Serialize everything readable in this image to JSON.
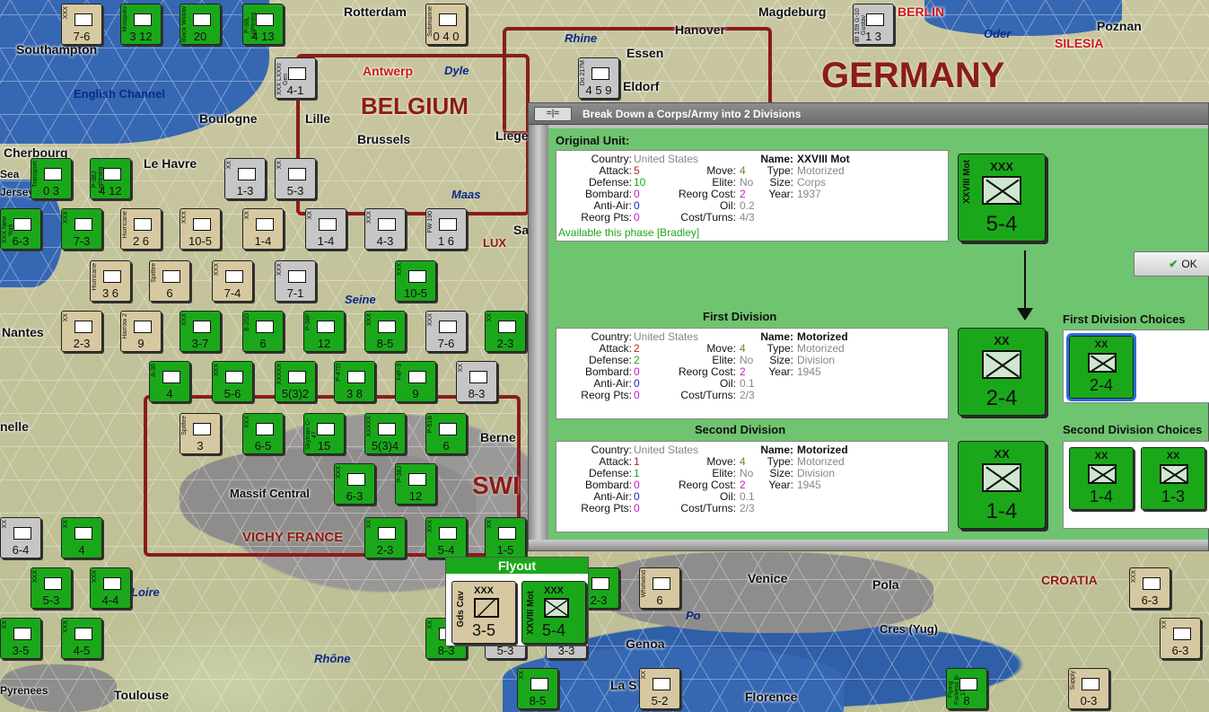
{
  "map": {
    "countries": [
      {
        "id": "germany",
        "label": "GERMANY"
      },
      {
        "id": "belgium",
        "label": "BELGIUM"
      },
      {
        "id": "vichy",
        "label": "VICHY FRANCE"
      },
      {
        "id": "croatia",
        "label": "CROATIA"
      },
      {
        "id": "lux",
        "label": "LUX"
      },
      {
        "id": "swi",
        "label": "SWI"
      }
    ],
    "places": [
      "Rotterdam",
      "Magdeburg",
      "BERLIN",
      "Poznan",
      "Hanover",
      "Essen",
      "Eldorf",
      "Southampton",
      "Boulogne",
      "Lille",
      "Brussels",
      "Liege",
      "Cherbourg",
      "Le Havre",
      "Nantes",
      "Berne",
      "Massif Central",
      "Venice",
      "Pola",
      "Cres (Yug)",
      "Genoa",
      "Toulouse",
      "Pyrenees",
      "Florence",
      "La S",
      "Antwerp",
      "SILESIA",
      "Jersey",
      "Sea",
      "nelle",
      "Sa"
    ],
    "waters": [
      "English Channel",
      "Rhine",
      "Dyle",
      "Oder",
      "Maas",
      "Seine",
      "Rhône",
      "Po",
      "Loire"
    ]
  },
  "counters": [
    {
      "id": "c1",
      "type": "XXX",
      "strength": "7-6",
      "color": "tan"
    },
    {
      "id": "c2",
      "type": "Mosquito",
      "strength": "3 12",
      "color": "g"
    },
    {
      "id": "c3",
      "type": "Black Widow",
      "strength": "20",
      "color": "g"
    },
    {
      "id": "c4",
      "type": "P-38L Lightning",
      "strength": "4 13",
      "color": "g"
    },
    {
      "id": "c5",
      "type": "Submarine",
      "strength": "0 4 0",
      "color": "tan"
    },
    {
      "id": "c6",
      "type": "Bf 109 G-10 Gustav",
      "strength": "1 3",
      "color": "gr"
    },
    {
      "id": "c7",
      "type": "XXX LXXXI Gen",
      "strength": "4-1",
      "color": "gr"
    },
    {
      "id": "c8",
      "type": "Do 217M",
      "strength": "4 5 9",
      "color": "gr"
    },
    {
      "id": "c9",
      "type": "Transport",
      "strength": "0 3",
      "color": "g"
    },
    {
      "id": "c10",
      "type": "P-38J Lightning",
      "strength": "4 12",
      "color": "g"
    },
    {
      "id": "c11",
      "type": "XX",
      "strength": "1-3",
      "color": "gr"
    },
    {
      "id": "c12",
      "type": "XX",
      "strength": "5-3",
      "color": "gr"
    },
    {
      "id": "c13",
      "type": "XXX New York",
      "strength": "6-3",
      "color": "g"
    },
    {
      "id": "c14",
      "type": "XXX",
      "strength": "7-3",
      "color": "g"
    },
    {
      "id": "c15",
      "type": "Hurricane",
      "strength": "2 6",
      "color": "tan"
    },
    {
      "id": "c16",
      "type": "XXX",
      "strength": "10-5",
      "color": "tan"
    },
    {
      "id": "c17",
      "type": "XX",
      "strength": "1-4",
      "color": "tan"
    },
    {
      "id": "c18",
      "type": "XX",
      "strength": "1-4",
      "color": "gr"
    },
    {
      "id": "c19",
      "type": "XXX",
      "strength": "4-3",
      "color": "gr"
    },
    {
      "id": "c20",
      "type": "FW 190",
      "strength": "1 6",
      "color": "gr"
    },
    {
      "id": "c21",
      "type": "XXX",
      "strength": "10-5",
      "color": "g"
    },
    {
      "id": "c22",
      "type": "Spitfire",
      "strength": "6",
      "color": "tan"
    },
    {
      "id": "c23",
      "type": "XXX",
      "strength": "7-4",
      "color": "tan"
    },
    {
      "id": "c24",
      "type": "XXX",
      "strength": "7-1",
      "color": "gr"
    },
    {
      "id": "c25",
      "type": "Hurricane",
      "strength": "3 6",
      "color": "tan"
    },
    {
      "id": "c26",
      "type": "Harrow 2",
      "strength": "9",
      "color": "tan"
    },
    {
      "id": "c27",
      "type": "XX",
      "strength": "2-3",
      "color": "tan"
    },
    {
      "id": "c28",
      "type": "XXX",
      "strength": "3-7",
      "color": "g"
    },
    {
      "id": "c29",
      "type": "B-25D",
      "strength": "6",
      "color": "g"
    },
    {
      "id": "c30",
      "type": "P-38F",
      "strength": "12",
      "color": "g"
    },
    {
      "id": "c31",
      "type": "XXX",
      "strength": "8-5",
      "color": "g"
    },
    {
      "id": "c32",
      "type": "XXX",
      "strength": "7-6",
      "color": "gr"
    },
    {
      "id": "c33",
      "type": "XX",
      "strength": "2-3",
      "color": "g"
    },
    {
      "id": "c34",
      "type": "A-36",
      "strength": "4",
      "color": "g"
    },
    {
      "id": "c35",
      "type": "XXX",
      "strength": "5-6",
      "color": "g"
    },
    {
      "id": "c36",
      "type": "XXXXX",
      "strength": "5(3)2",
      "color": "g"
    },
    {
      "id": "c37",
      "type": "P-47D",
      "strength": "3 8",
      "color": "g"
    },
    {
      "id": "c38",
      "type": "F4F-3",
      "strength": "9",
      "color": "g"
    },
    {
      "id": "c39",
      "type": "XX",
      "strength": "8-3",
      "color": "gr"
    },
    {
      "id": "c40",
      "type": "Spitfire",
      "strength": "3",
      "color": "tan"
    },
    {
      "id": "c41",
      "type": "XXX",
      "strength": "6-5",
      "color": "g"
    },
    {
      "id": "c42",
      "type": "Skytrain C-47",
      "strength": "15",
      "color": "g"
    },
    {
      "id": "c43",
      "type": "XXXXX",
      "strength": "5(3)4",
      "color": "g"
    },
    {
      "id": "c44",
      "type": "P-51B",
      "strength": "6",
      "color": "g"
    },
    {
      "id": "c45",
      "type": "XXX",
      "strength": "6-3",
      "color": "g"
    },
    {
      "id": "c46",
      "type": "P-38J",
      "strength": "12",
      "color": "g"
    },
    {
      "id": "c47",
      "type": "XX",
      "strength": "6-4",
      "color": "gr"
    },
    {
      "id": "c48",
      "type": "XX",
      "strength": "4",
      "color": "g"
    },
    {
      "id": "c49",
      "type": "XX",
      "strength": "2-3",
      "color": "g"
    },
    {
      "id": "c50",
      "type": "XXX",
      "strength": "5-4",
      "color": "g"
    },
    {
      "id": "c51",
      "type": "XX",
      "strength": "1-5",
      "color": "g"
    },
    {
      "id": "c52",
      "type": "XXX",
      "strength": "5-3",
      "color": "g"
    },
    {
      "id": "c53",
      "type": "XXX",
      "strength": "4-4",
      "color": "g"
    },
    {
      "id": "c54",
      "type": "XX",
      "strength": "3-5",
      "color": "g"
    },
    {
      "id": "c55",
      "type": "XXX",
      "strength": "4-5",
      "color": "g"
    },
    {
      "id": "c56",
      "type": "Whirlwind",
      "strength": "6",
      "color": "tan"
    },
    {
      "id": "c57",
      "type": "XXX",
      "strength": "2-3",
      "color": "g"
    },
    {
      "id": "c58",
      "type": "XXX",
      "strength": "6-3",
      "color": "tan"
    },
    {
      "id": "c59",
      "type": "XX",
      "strength": "6-3",
      "color": "tan"
    },
    {
      "id": "c60",
      "type": "XX",
      "strength": "8-3",
      "color": "g"
    },
    {
      "id": "c61",
      "type": "XXX",
      "strength": "5-3",
      "color": "gr"
    },
    {
      "id": "c62",
      "type": "XXX",
      "strength": "3-3",
      "color": "gr"
    },
    {
      "id": "c63",
      "type": "XX",
      "strength": "8-5",
      "color": "g"
    },
    {
      "id": "c64",
      "type": "XX",
      "strength": "5-2",
      "color": "tan"
    },
    {
      "id": "c65",
      "type": "Flying Fortress B-17G",
      "strength": "8",
      "color": "g"
    },
    {
      "id": "c66",
      "type": "Supply",
      "strength": "0-3",
      "color": "tan"
    }
  ],
  "dialog": {
    "title": "Break Down a Corps/Army into 2 Divisions",
    "title_icon": "=|=",
    "ok_label": "OK",
    "original": {
      "section_label": "Original Unit:",
      "country_label": "Country:",
      "country": "United States",
      "attack_label": "Attack:",
      "attack": "5",
      "defense_label": "Defense:",
      "defense": "10",
      "bombard_label": "Bombard:",
      "bombard": "0",
      "antiair_label": "Anti-Air:",
      "antiair": "0",
      "reorgpts_label": "Reorg Pts:",
      "reorgpts": "0",
      "move_label": "Move:",
      "move": "4",
      "elite_label": "Elite:",
      "elite": "No",
      "reorgcost_label": "Reorg Cost:",
      "reorgcost": "2",
      "oil_label": "Oil:",
      "oil": "0.2",
      "costturns_label": "Cost/Turns:",
      "costturns": "4/3",
      "name_label": "Name:",
      "name": "XXVIII Mot",
      "type_label": "Type:",
      "type": "Motorized",
      "size_label": "Size:",
      "size": "Corps",
      "year_label": "Year:",
      "year": "1937",
      "available": "Available this phase [Bradley]",
      "counter_size": "XXX",
      "counter_strength": "5-4",
      "counter_name": "XXVIII Mot"
    },
    "first": {
      "section_label": "First Division",
      "choices_label": "First Division Choices",
      "country_label": "Country:",
      "country": "United States",
      "attack_label": "Attack:",
      "attack": "2",
      "defense_label": "Defense:",
      "defense": "2",
      "bombard_label": "Bombard:",
      "bombard": "0",
      "antiair_label": "Anti-Air:",
      "antiair": "0",
      "reorgpts_label": "Reorg Pts:",
      "reorgpts": "0",
      "move_label": "Move:",
      "move": "4",
      "elite_label": "Elite:",
      "elite": "No",
      "reorgcost_label": "Reorg Cost:",
      "reorgcost": "2",
      "oil_label": "Oil:",
      "oil": "0.1",
      "costturns_label": "Cost/Turns:",
      "costturns": "2/3",
      "name_label": "Name:",
      "name": "Motorized",
      "type_label": "Type:",
      "type": "Motorized",
      "size_label": "Size:",
      "size": "Division",
      "year_label": "Year:",
      "year": "1945",
      "counter_size": "XX",
      "counter_strength": "2-4",
      "choices": [
        {
          "size": "XX",
          "strength": "2-4",
          "selected": true
        }
      ]
    },
    "second": {
      "section_label": "Second Division",
      "choices_label": "Second Division Choices",
      "country_label": "Country:",
      "country": "United States",
      "attack_label": "Attack:",
      "attack": "1",
      "defense_label": "Defense:",
      "defense": "1",
      "bombard_label": "Bombard:",
      "bombard": "0",
      "antiair_label": "Anti-Air:",
      "antiair": "0",
      "reorgpts_label": "Reorg Pts:",
      "reorgpts": "0",
      "move_label": "Move:",
      "move": "4",
      "elite_label": "Elite:",
      "elite": "No",
      "reorgcost_label": "Reorg Cost:",
      "reorgcost": "2",
      "oil_label": "Oil:",
      "oil": "0.1",
      "costturns_label": "Cost/Turns:",
      "costturns": "2/3",
      "name_label": "Name:",
      "name": "Motorized",
      "type_label": "Type:",
      "type": "Motorized",
      "size_label": "Size:",
      "size": "Division",
      "year_label": "Year:",
      "year": "1945",
      "counter_size": "XX",
      "counter_strength": "1-4",
      "choices": [
        {
          "size": "XX",
          "strength": "1-4",
          "selected": false
        },
        {
          "size": "XX",
          "strength": "1-3",
          "selected": false
        }
      ]
    }
  },
  "flyout": {
    "title": "Flyout",
    "units": [
      {
        "name": "Gds Cav",
        "size": "XXX",
        "strength": "3-5",
        "color": "#d6c8a0"
      },
      {
        "name": "XXVIII Mot",
        "size": "XXX",
        "strength": "5-4",
        "color": "#1aa81a"
      }
    ]
  },
  "colors": {
    "us_green": "#1aa81a",
    "border_red": "#8a1c1c",
    "dialog_bg": "#6fc46f"
  }
}
